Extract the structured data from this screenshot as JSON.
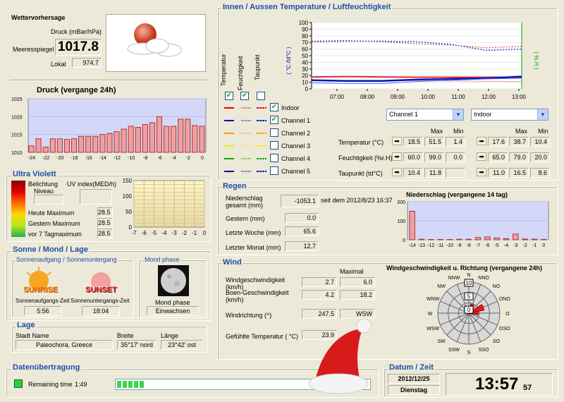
{
  "forecast": {
    "title": "Wettervorhersage",
    "druck_label": "Druck (mBar/hPa)",
    "meeresspiegel_label": "Meeresspiegel",
    "meeresspiegel_value": "1017.8",
    "lokal_label": "Lokal",
    "lokal_value": "974.7",
    "icon": "sun-behind-cloud-icon"
  },
  "pressure_chart": {
    "title": "Druck (vergange 24h)"
  },
  "uv": {
    "title": "Ultra Violett",
    "belichtung_label": "Belichtung",
    "niveau_label": "Niveau",
    "uv_index_label": "UV index(MED/h)",
    "heute_label": "Heute Maximum",
    "heute_value": "28.5",
    "gestern_label": "Gestern Maximum",
    "gestern_value": "28.5",
    "vor7_label": "vor 7 Tagmaximum",
    "vor7_value": "28.5"
  },
  "sun_moon": {
    "title": "Sonne / Mond / Lage",
    "sun_sub": "Sonnenaufgang / Sonnenuntergang",
    "moon_sub": "Mond phase",
    "sunrise_icon_text": "SUNRISE",
    "sunset_icon_text": "SUNSET",
    "sunrise_label": "Sonnenaufgangs-Zeit",
    "sunset_label": "Sonnenuntergangs-Zeit",
    "sunrise_value": "5:56",
    "sunset_value": "18:04",
    "moon_label": "Mond phase",
    "moon_value": "Einwachsen"
  },
  "lage": {
    "title": "Lage",
    "stadt_label": "Stadt Name",
    "stadt_value": "Paleochora, Greece",
    "breite_label": "Breite",
    "breite_value": "35°17' nord",
    "laenge_label": "Länge",
    "laenge_value": "23°42' ost"
  },
  "transfer": {
    "title": "Datenübertragung",
    "remaining_label": "Remaining time",
    "remaining_value": "1:49",
    "progress": 0.11
  },
  "temp": {
    "title": "Innen / Aussen Temperature / Luftfeuchtigkeit",
    "col_temp": "Temperatur",
    "col_feucht": "Feuchtigkeit",
    "col_tau": "Taupunkt",
    "yaxis_left": "( °C /td°C )",
    "yaxis_right": "( %.H )",
    "channels": [
      {
        "label": "Indoor",
        "checked": true
      },
      {
        "label": "Channel 1",
        "checked": true
      },
      {
        "label": "Channel 2",
        "checked": false
      },
      {
        "label": "Channel 3",
        "checked": false
      },
      {
        "label": "Channel 4",
        "checked": false
      },
      {
        "label": "Channel 5",
        "checked": false
      }
    ],
    "select_left": "Channel 1",
    "select_right": "Indoor",
    "max_label": "Max",
    "min_label": "Min",
    "temp_label": "Temperatur (°C)",
    "feucht_label": "Feuchtigkeit (%r.H)",
    "tau_label": "Taupunkt (td°C)",
    "left_vals": {
      "temp": [
        "18.5",
        "51.5",
        "1.4"
      ],
      "feucht": [
        "60.0",
        "99.0",
        "0.0"
      ],
      "tau": [
        "10.4",
        "11.8",
        ""
      ]
    },
    "right_vals": {
      "temp": [
        "17.6",
        "38.7",
        "10.4"
      ],
      "feucht": [
        "65.0",
        "79.0",
        "20.0"
      ],
      "tau": [
        "11.0",
        "16.5",
        "8.6"
      ]
    }
  },
  "regen": {
    "title": "Regen",
    "gesamt_label": "Niederschlag gesamt (mm)",
    "gesamt_value": "-1053.1",
    "seit_label": "seit dem 2012/8/23 16:37",
    "gestern_label": "Gestern (mm)",
    "gestern_value": "0.0",
    "woche_label": "Letzte Woche (mm)",
    "woche_value": "65.6",
    "monat_label": "Letzter Monat (mm)",
    "monat_value": "12.7",
    "chart_title": "Niederschlag (vergangene 14 tag)"
  },
  "wind": {
    "title": "Wind",
    "maximal_label": "Maximal",
    "speed_label": "Windgeschwindigkeit (km/h)",
    "speed_value": "2.7",
    "speed_max": "6.0",
    "gust_label": "Boen-Geschwindigkeit (km/h)",
    "gust_value": "4.2",
    "gust_max": "18.2",
    "dir_label": "Windrichtung (^)",
    "dir_value": "247.5",
    "dir_text": "WSW",
    "feel_label": "Gefühlte Temperatur ( °C)",
    "feel_value": "23.9",
    "chart_title": "Windgeschwindigkeit u. Richtung (vergangene 24h)",
    "compass": [
      "N",
      "NNO",
      "NO",
      "ONO",
      "O",
      "OSO",
      "SO",
      "SSO",
      "S",
      "SSW",
      "SW",
      "WSW",
      "W",
      "WNW",
      "NW",
      "NNW"
    ],
    "rose_ticks": [
      "10",
      "5",
      "0"
    ],
    "rose_values": [
      0,
      0.3,
      0.2,
      0.5,
      0.3,
      0,
      0,
      0,
      0,
      0,
      0,
      0,
      0,
      0,
      0,
      0
    ]
  },
  "datetime": {
    "title": "Datum / Zeit",
    "date": "2012/12/25",
    "weekday": "Dienstag",
    "time": "13:57",
    "seconds": "57"
  },
  "chart_data": [
    {
      "type": "bar",
      "title": "Druck (vergange 24h)",
      "x": [
        -24,
        -23,
        -22,
        -21,
        -20,
        -19,
        -18,
        -17,
        -16,
        -15,
        -14,
        -13,
        -12,
        -11,
        -10,
        -9,
        -8,
        -7,
        -6,
        -5,
        -4,
        -3,
        -2,
        -1,
        0
      ],
      "values": [
        1011.8,
        1013.8,
        1011.5,
        1013.8,
        1013.8,
        1013.6,
        1013.8,
        1014.5,
        1014.5,
        1014.5,
        1015,
        1015.3,
        1015.8,
        1016.5,
        1017.3,
        1017,
        1017.8,
        1018.3,
        1020,
        1017.3,
        1017.3,
        1019.3,
        1019.3,
        1017.5,
        1017.3
      ],
      "xticks": [
        -24,
        -22,
        -20,
        -18,
        -16,
        -14,
        -12,
        -10,
        -8,
        -6,
        -4,
        -2,
        0
      ],
      "ylim": [
        1010,
        1025
      ],
      "yticks": [
        1010,
        1015,
        1020,
        1025
      ]
    },
    {
      "type": "line",
      "title": "",
      "x": [
        "07:00",
        "08:00",
        "09:00",
        "10:00",
        "11:00",
        "12:00",
        "13:00"
      ],
      "ylim": [
        0,
        100
      ],
      "yticks": [
        0,
        10,
        20,
        30,
        40,
        50,
        60,
        70,
        80,
        90,
        100
      ],
      "series": [
        {
          "name": "Indoor",
          "values": [
            72,
            73,
            71,
            68,
            66,
            62,
            64
          ]
        },
        {
          "name": "Indoor",
          "values": [
            18,
            18.5,
            18,
            17.5,
            17.6,
            17.6,
            17.6
          ]
        },
        {
          "name": "Indoor",
          "values": [
            13,
            12,
            12,
            12.5,
            12,
            11.5,
            11
          ]
        },
        {
          "name": "Channel 1",
          "values": [
            13,
            12,
            12,
            14,
            15,
            16,
            18.5
          ]
        },
        {
          "name": "Channel 1",
          "values": [
            71,
            72,
            72,
            71,
            67,
            58,
            60
          ]
        },
        {
          "name": "Channel 1",
          "values": [
            9,
            8,
            8,
            11,
            13,
            15,
            16
          ]
        }
      ]
    },
    {
      "type": "bar",
      "title": "Niederschlag (vergangene 14 tag)",
      "x": [
        -14,
        -13,
        -12,
        -11,
        -10,
        -9,
        -8,
        -7,
        -6,
        -5,
        -4,
        -3,
        -2,
        -1,
        0
      ],
      "values": [
        150,
        3,
        2,
        2,
        2,
        3,
        3,
        12,
        15,
        10,
        6,
        30,
        4,
        3,
        2
      ],
      "ylim": [
        0,
        200
      ],
      "yticks": [
        0,
        100,
        200
      ]
    },
    {
      "type": "bar",
      "title": "",
      "xlabel": "",
      "ylim": [
        0,
        150
      ],
      "yticks": [
        0,
        50,
        100,
        150
      ],
      "x": [
        -7,
        -6,
        -5,
        -4,
        -3,
        -2,
        -1,
        0
      ],
      "values": [
        0,
        0,
        0,
        0,
        0,
        0,
        0,
        0
      ]
    }
  ]
}
